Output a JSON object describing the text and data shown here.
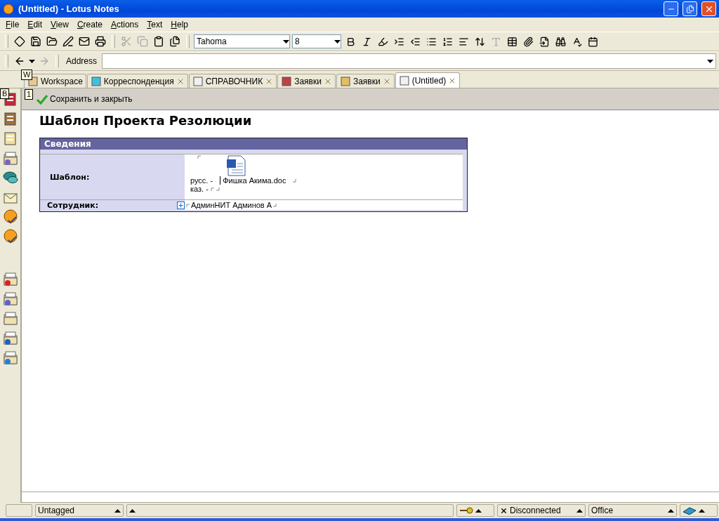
{
  "window": {
    "title": "(Untitled) - Lotus Notes"
  },
  "menu": [
    "File",
    "Edit",
    "View",
    "Create",
    "Actions",
    "Text",
    "Help"
  ],
  "toolbar": {
    "font": "Tahoma",
    "size": "8"
  },
  "address_bar": {
    "label": "Address"
  },
  "workspace_hint": "W",
  "tabs": [
    {
      "label": "Workspace",
      "closable": false,
      "selected": false
    },
    {
      "label": "Корреспонденция",
      "closable": true,
      "selected": false
    },
    {
      "label": "СПРАВОЧНИК",
      "closable": true,
      "selected": false
    },
    {
      "label": "Заявки",
      "closable": true,
      "selected": false
    },
    {
      "label": "Заявки",
      "closable": true,
      "selected": false
    },
    {
      "label": "(Untitled)",
      "closable": true,
      "selected": true
    }
  ],
  "bookmark_hint": "B",
  "action_bar": {
    "hint": "1",
    "actions": [
      "Сохранить и закрыть"
    ]
  },
  "form": {
    "title": "Шаблон Проекта Резолюции",
    "section": "Сведения",
    "fields": [
      {
        "kind": "attachment",
        "label": "Шаблон:",
        "lines": [
          "русс. -",
          "каз. -"
        ],
        "attachment": "Фишка Акима.doc"
      },
      {
        "kind": "names",
        "label": "Сотрудник:",
        "value": "АдминНИТ Админов А"
      }
    ]
  },
  "status_bar": [
    {
      "kind": "blank"
    },
    {
      "kind": "dropdown",
      "text": "Untagged"
    },
    {
      "kind": "dropdown"
    },
    {
      "kind": "security"
    },
    {
      "kind": "location",
      "text": "Disconnected"
    },
    {
      "kind": "dropdown",
      "text": "Office"
    },
    {
      "kind": "replication"
    }
  ]
}
